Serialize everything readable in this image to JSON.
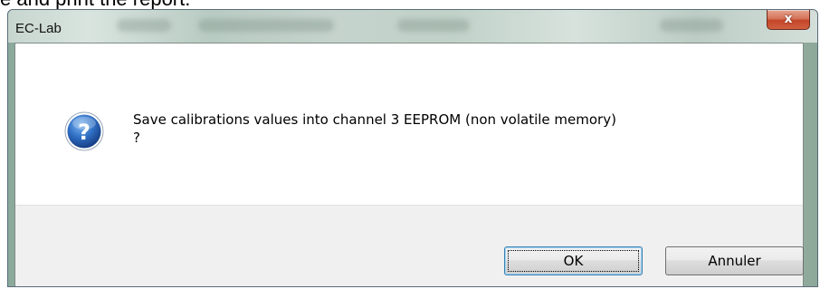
{
  "background": {
    "partial_text": "e and print the report."
  },
  "window": {
    "title": "EC-Lab",
    "close_glyph": "x"
  },
  "dialog": {
    "icon": "question-icon",
    "message_line1": "Save calibrations values into channel 3 EEPROM (non volatile memory)",
    "message_line2": "?"
  },
  "buttons": {
    "ok_label": "OK",
    "cancel_label": "Annuler"
  },
  "colors": {
    "icon_blue": "#1f5fb4",
    "close_red": "#c4462a",
    "button_area": "#f0f0f0"
  }
}
